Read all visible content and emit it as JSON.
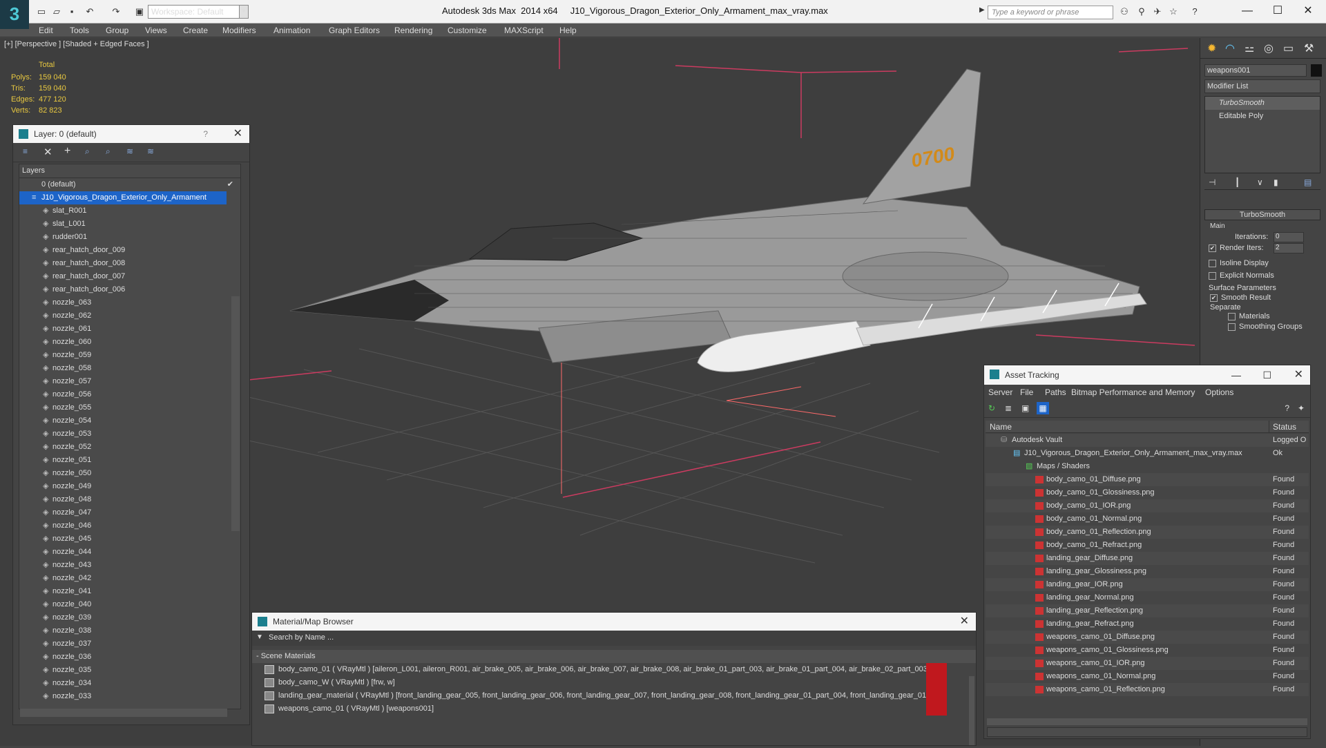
{
  "app": {
    "title": "Autodesk 3ds Max  2014 x64     J10_Vigorous_Dragon_Exterior_Only_Armament_max_vray.max",
    "logo": "3",
    "workspace": "Workspace: Default",
    "search_placeholder": "Type a keyword or phrase"
  },
  "menu": [
    "Edit",
    "Tools",
    "Group",
    "Views",
    "Create",
    "Modifiers",
    "Animation",
    "Graph Editors",
    "Rendering",
    "Customize",
    "MAXScript",
    "Help"
  ],
  "viewport": {
    "label": "[+] [Perspective ] [Shaded + Edged Faces ]",
    "stats": {
      "header": "Total",
      "rows": [
        {
          "label": "Polys:",
          "value": "159 040"
        },
        {
          "label": "Tris:",
          "value": "159 040"
        },
        {
          "label": "Edges:",
          "value": "477 120"
        },
        {
          "label": "Verts:",
          "value": "82 823"
        }
      ]
    },
    "tail_marking": "0700"
  },
  "layer_panel": {
    "title": "Layer: 0 (default)",
    "help": "?",
    "close": "✕",
    "header": "Layers",
    "default_layer": "0 (default)",
    "selected_layer": "J10_Vigorous_Dragon_Exterior_Only_Armament",
    "items": [
      "slat_R001",
      "slat_L001",
      "rudder001",
      "rear_hatch_door_009",
      "rear_hatch_door_008",
      "rear_hatch_door_007",
      "rear_hatch_door_006",
      "nozzle_063",
      "nozzle_062",
      "nozzle_061",
      "nozzle_060",
      "nozzle_059",
      "nozzle_058",
      "nozzle_057",
      "nozzle_056",
      "nozzle_055",
      "nozzle_054",
      "nozzle_053",
      "nozzle_052",
      "nozzle_051",
      "nozzle_050",
      "nozzle_049",
      "nozzle_048",
      "nozzle_047",
      "nozzle_046",
      "nozzle_045",
      "nozzle_044",
      "nozzle_043",
      "nozzle_042",
      "nozzle_041",
      "nozzle_040",
      "nozzle_039",
      "nozzle_038",
      "nozzle_037",
      "nozzle_036",
      "nozzle_035",
      "nozzle_034",
      "nozzle_033"
    ]
  },
  "command_panel": {
    "object_name": "weapons001",
    "modifier_list": "Modifier List",
    "stack": [
      "TurboSmooth",
      "Editable Poly"
    ],
    "rollout_title": "TurboSmooth",
    "main_label": "Main",
    "iterations_label": "Iterations:",
    "iterations_value": "0",
    "render_iters_label": "Render Iters:",
    "render_iters_value": "2",
    "isoline": "Isoline Display",
    "explicit_normals": "Explicit Normals",
    "surface_params": "Surface Parameters",
    "smooth_result": "Smooth Result",
    "separate": "Separate",
    "materials": "Materials",
    "smoothing_groups": "Smoothing Groups"
  },
  "material_browser": {
    "title": "Material/Map Browser",
    "search_placeholder": "Search by Name ...",
    "group": "- Scene Materials",
    "rows": [
      "body_camo_01  ( VRayMtl )  [aileron_L001, aileron_R001, air_brake_005, air_brake_006, air_brake_007, air_brake_008, air_brake_01_part_003, air_brake_01_part_004, air_brake_02_part_003,...",
      "body_camo_W  ( VRayMtl )  [frw, w]",
      "landing_gear_material  ( VRayMtl )  [front_landing_gear_005, front_landing_gear_006, front_landing_gear_007, front_landing_gear_008, front_landing_gear_01_part_004, front_landing_gear_01...",
      "weapons_camo_01  ( VRayMtl )  [weapons001]"
    ]
  },
  "asset_tracking": {
    "title": "Asset Tracking",
    "menu": [
      "Server",
      "File",
      "Paths",
      "Bitmap Performance and Memory",
      "Options"
    ],
    "col_name": "Name",
    "col_status": "Status",
    "vault": {
      "name": "Autodesk Vault",
      "status": "Logged O"
    },
    "file": {
      "name": "J10_Vigorous_Dragon_Exterior_Only_Armament_max_vray.max",
      "status": "Ok"
    },
    "maps_folder": "Maps / Shaders",
    "assets": [
      {
        "name": "body_camo_01_Diffuse.png",
        "status": "Found"
      },
      {
        "name": "body_camo_01_Glossiness.png",
        "status": "Found"
      },
      {
        "name": "body_camo_01_IOR.png",
        "status": "Found"
      },
      {
        "name": "body_camo_01_Normal.png",
        "status": "Found"
      },
      {
        "name": "body_camo_01_Reflection.png",
        "status": "Found"
      },
      {
        "name": "body_camo_01_Refract.png",
        "status": "Found"
      },
      {
        "name": "landing_gear_Diffuse.png",
        "status": "Found"
      },
      {
        "name": "landing_gear_Glossiness.png",
        "status": "Found"
      },
      {
        "name": "landing_gear_IOR.png",
        "status": "Found"
      },
      {
        "name": "landing_gear_Normal.png",
        "status": "Found"
      },
      {
        "name": "landing_gear_Reflection.png",
        "status": "Found"
      },
      {
        "name": "landing_gear_Refract.png",
        "status": "Found"
      },
      {
        "name": "weapons_camo_01_Diffuse.png",
        "status": "Found"
      },
      {
        "name": "weapons_camo_01_Glossiness.png",
        "status": "Found"
      },
      {
        "name": "weapons_camo_01_IOR.png",
        "status": "Found"
      },
      {
        "name": "weapons_camo_01_Normal.png",
        "status": "Found"
      },
      {
        "name": "weapons_camo_01_Reflection.png",
        "status": "Found"
      }
    ]
  },
  "colors": {
    "selection": "#1d64c8",
    "accent": "#1c7f8e",
    "stats": "#e8c840",
    "grid_axis": "#d04060"
  }
}
